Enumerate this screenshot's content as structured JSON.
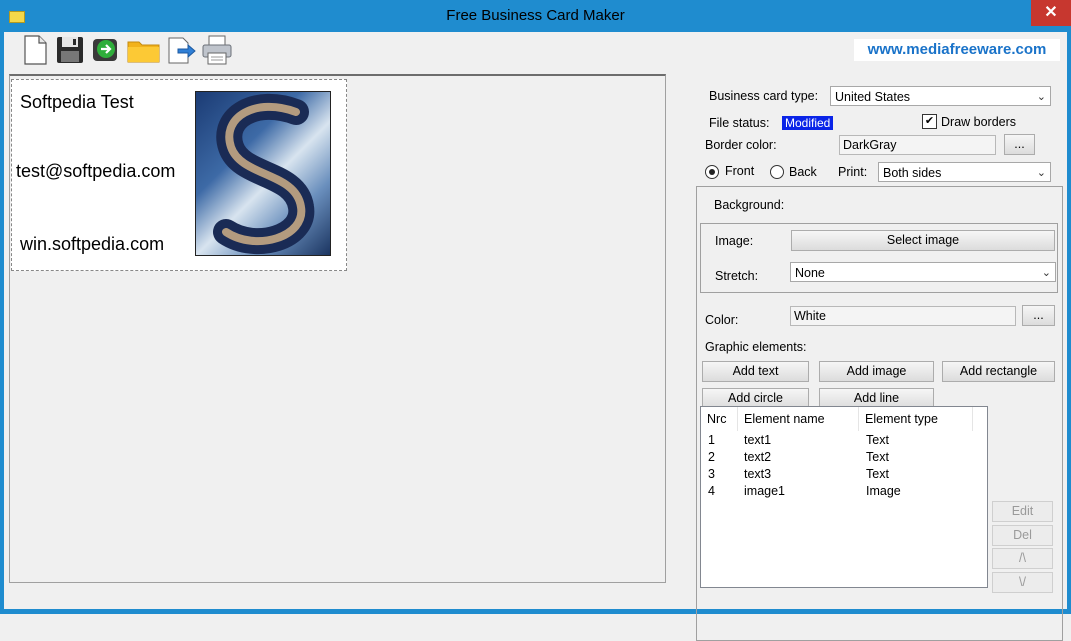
{
  "window": {
    "title": "Free Business Card Maker",
    "close_glyph": "✕"
  },
  "toolbar": {
    "buttons": [
      {
        "name": "new-document-icon"
      },
      {
        "name": "save-icon"
      },
      {
        "name": "export-icon"
      },
      {
        "name": "open-folder-icon"
      },
      {
        "name": "send-icon"
      },
      {
        "name": "print-icon"
      }
    ],
    "site_link": "www.mediafreeware.com"
  },
  "card": {
    "lines": [
      "Softpedia Test",
      "test@softpedia.com",
      "win.softpedia.com"
    ]
  },
  "settings": {
    "card_type_label": "Business card type:",
    "card_type_value": "United States",
    "file_status_label": "File status:",
    "file_status_value": "Modified",
    "draw_borders_label": "Draw borders",
    "draw_borders_checked": true,
    "border_color_label": "Border color:",
    "border_color_value": "DarkGray",
    "browse_label": "...",
    "front_label": "Front",
    "back_label": "Back",
    "side_selected": "Front",
    "print_label": "Print:",
    "print_value": "Both sides"
  },
  "background": {
    "title": "Background:",
    "image_label": "Image:",
    "select_image_label": "Select image",
    "stretch_label": "Stretch:",
    "stretch_value": "None",
    "color_label": "Color:",
    "color_value": "White",
    "browse_label": "..."
  },
  "graphics": {
    "title": "Graphic elements:",
    "add_text": "Add text",
    "add_image": "Add image",
    "add_rectangle": "Add rectangle",
    "add_circle": "Add circle",
    "add_line": "Add line"
  },
  "elements_table": {
    "headers": [
      "Nrc",
      "Element name",
      "Element type"
    ],
    "rows": [
      [
        "1",
        "text1",
        "Text"
      ],
      [
        "2",
        "text2",
        "Text"
      ],
      [
        "3",
        "text3",
        "Text"
      ],
      [
        "4",
        "image1",
        "Image"
      ]
    ]
  },
  "side_buttons": {
    "edit": "Edit",
    "del": "Del",
    "up": "/\\",
    "down": "\\/"
  },
  "colors": {
    "titlebar": "#1f8ccf",
    "status_badge": "#0a24e8",
    "link": "#1a73c9"
  }
}
